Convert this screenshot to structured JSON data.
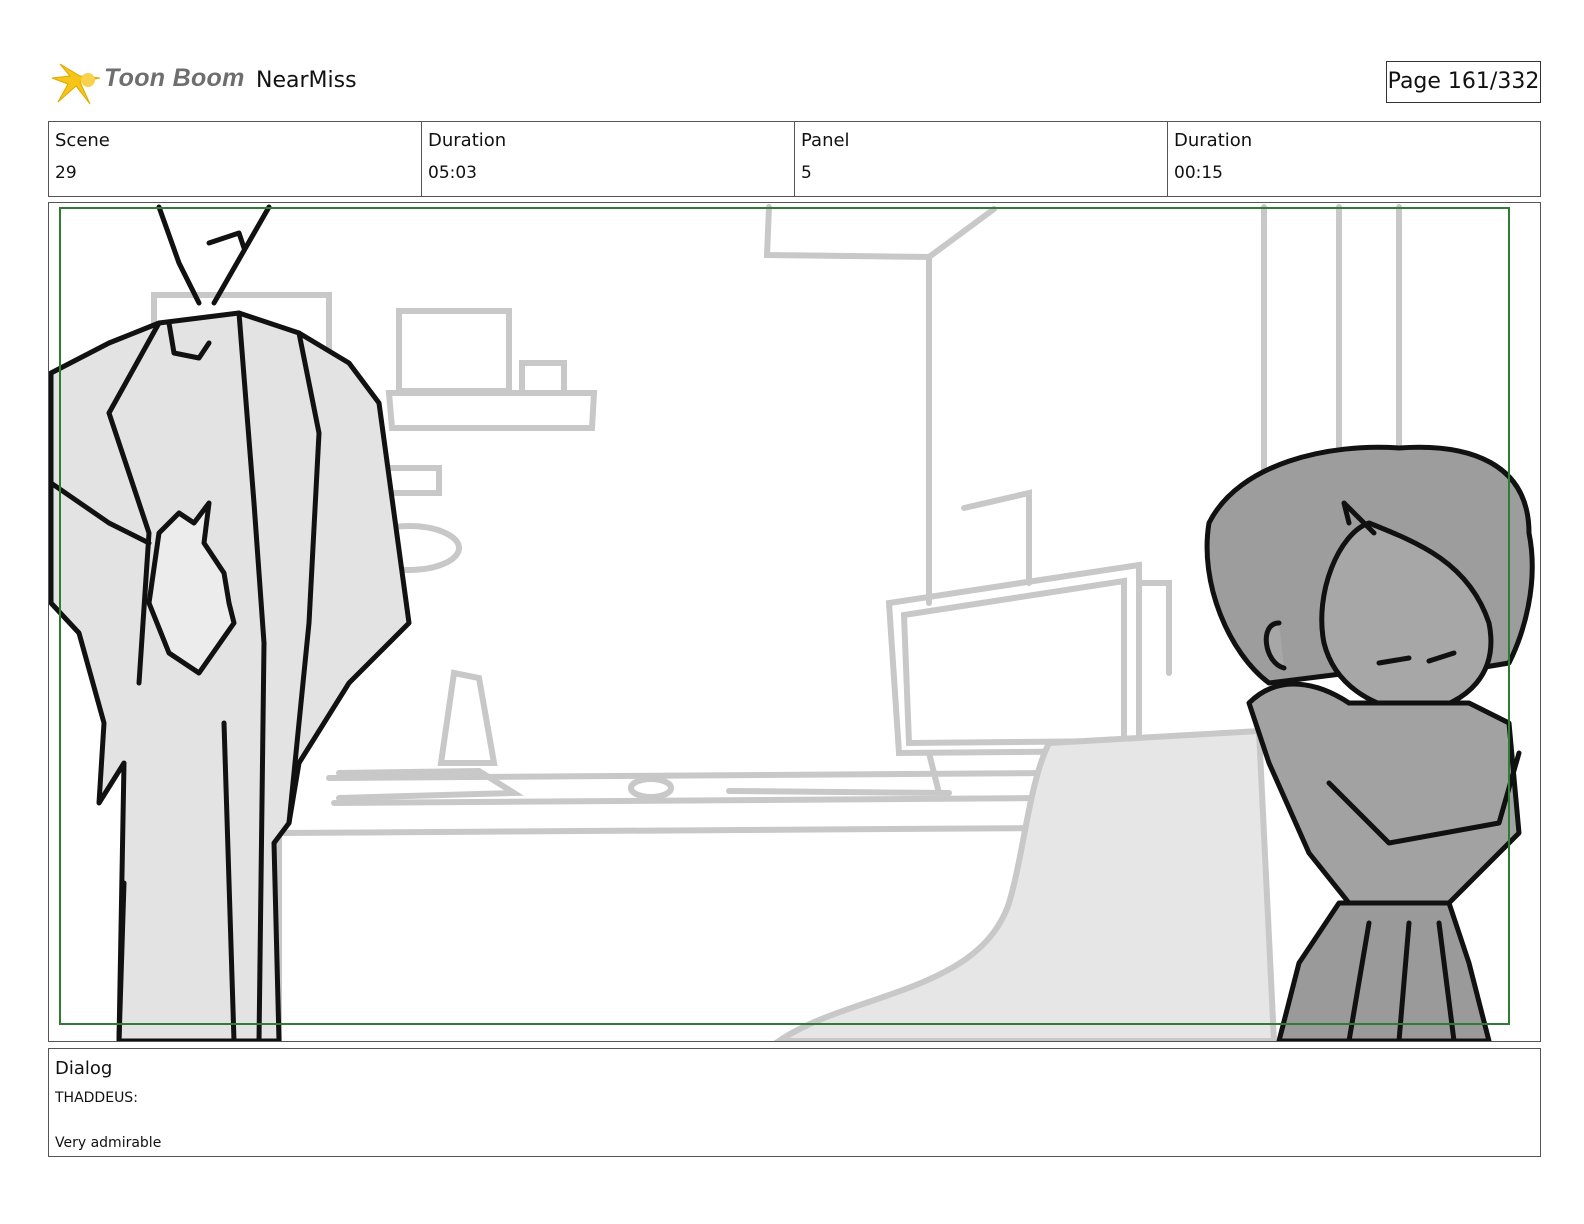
{
  "header": {
    "logo_text": "Toon Boom",
    "project_name": "NearMiss",
    "page_label": "Page 161/332"
  },
  "info": {
    "scene_label": "Scene",
    "scene_value": "29",
    "scene_duration_label": "Duration",
    "scene_duration_value": "05:03",
    "panel_label": "Panel",
    "panel_value": "5",
    "panel_duration_label": "Duration",
    "panel_duration_value": "00:15"
  },
  "dialog": {
    "label": "Dialog",
    "speaker": "THADDEUS:",
    "line": "Very admirable"
  },
  "colors": {
    "logo_accent": "#f5c518",
    "safe_frame": "#2e7d32",
    "sketch_light": "#c8c8c8",
    "character_fill": "#a8a8a8"
  }
}
